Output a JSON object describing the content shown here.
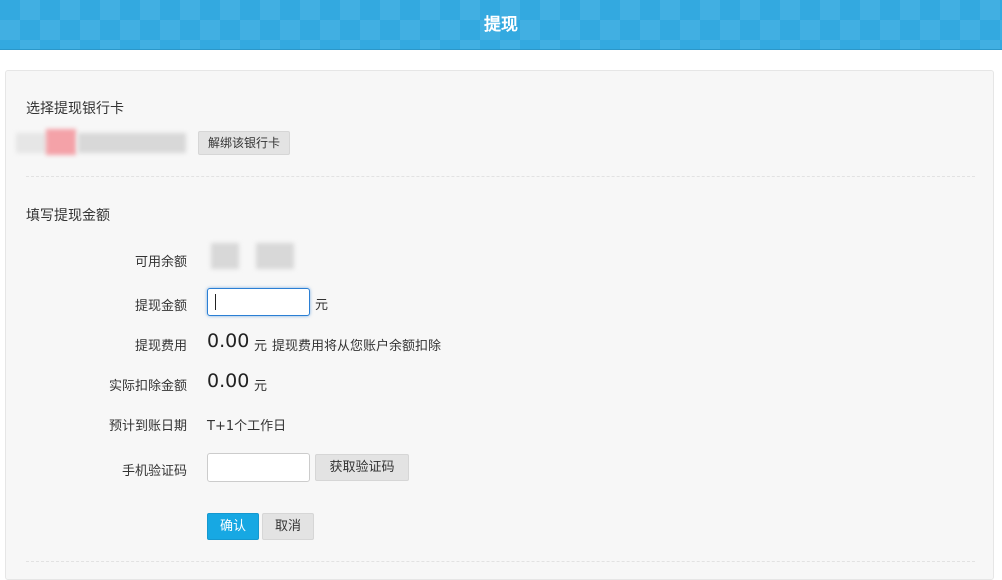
{
  "header": {
    "title": "提现"
  },
  "bank_section": {
    "title": "选择提现银行卡",
    "unbind_button": "解绑该银行卡"
  },
  "amount_section": {
    "title": "填写提现金额",
    "available_balance_label": "可用余额",
    "withdraw_amount_label": "提现金额",
    "withdraw_amount_value": "",
    "withdraw_amount_unit": "元",
    "fee_label": "提现费用",
    "fee_value": "0.00",
    "fee_unit": "元",
    "fee_note": "提现费用将从您账户余额扣除",
    "actual_deduction_label": "实际扣除金额",
    "actual_deduction_value": "0.00",
    "actual_deduction_unit": "元",
    "arrival_date_label": "预计到账日期",
    "arrival_date_value": "T+1个工作日",
    "sms_code_label": "手机验证码",
    "sms_code_value": "",
    "get_code_button": "获取验证码"
  },
  "actions": {
    "confirm": "确认",
    "cancel": "取消"
  },
  "colors": {
    "header_bg": "#33a9e0",
    "primary_button": "#17a8e3",
    "panel_bg": "#f7f7f7",
    "focus_border": "#2b7fd4"
  }
}
